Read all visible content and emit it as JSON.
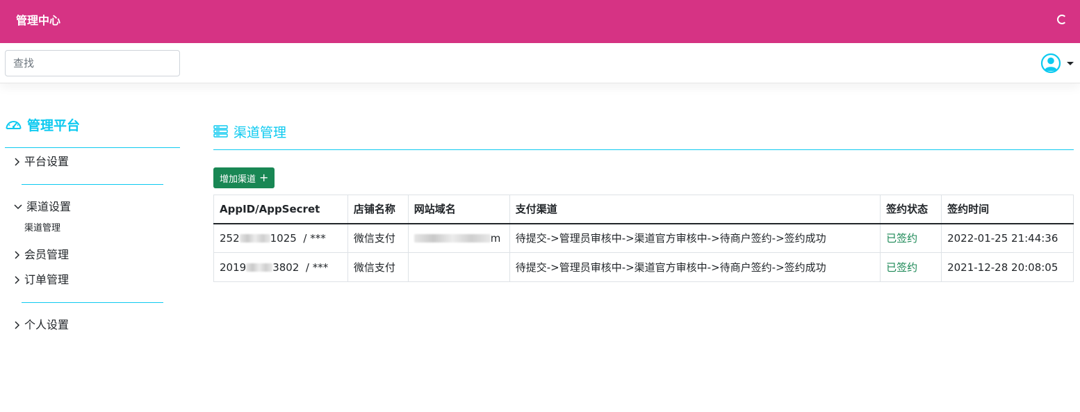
{
  "app": {
    "brand": "管理中心"
  },
  "search": {
    "placeholder": "查找"
  },
  "sidebar": {
    "title": "管理平台",
    "items": [
      {
        "label": "平台设置"
      },
      {
        "label": "渠道设置"
      },
      {
        "label": "会员管理"
      },
      {
        "label": "订单管理"
      },
      {
        "label": "个人设置"
      }
    ],
    "subitems": [
      {
        "label": "渠道管理"
      }
    ]
  },
  "main": {
    "title": "渠道管理",
    "add_button": "增加渠道",
    "table": {
      "headers": [
        "AppID/AppSecret",
        "店铺名称",
        "网站域名",
        "支付渠道",
        "签约状态",
        "签约时间"
      ],
      "rows": [
        {
          "appid_prefix": "252",
          "appid_suffix": "1025",
          "secret": "/  ***",
          "shop": "微信支付",
          "domain_suffix": "m",
          "channel": "待提交->管理员审核中->渠道官方审核中->待商户签约->签约成功",
          "status": "已签约",
          "time": "2022-01-25 21:44:36"
        },
        {
          "appid_prefix": "2019",
          "appid_suffix": "3802",
          "secret": "/  ***",
          "shop": "微信支付",
          "domain_suffix": "",
          "channel": "待提交->管理员审核中->渠道官方审核中->待商户签约->签约成功",
          "status": "已签约",
          "time": "2021-12-28 20:08:05"
        }
      ]
    }
  },
  "colors": {
    "header": "#d63384",
    "accent": "#0dcaf0",
    "success": "#198754"
  },
  "icons": {
    "loading": "spinner-icon",
    "user": "user-circle-icon",
    "dashboard": "speedometer-icon",
    "channel": "server-stack-icon",
    "collapsed": "chevron-right-icon",
    "expanded": "chevron-down-icon",
    "add": "plus-icon"
  }
}
